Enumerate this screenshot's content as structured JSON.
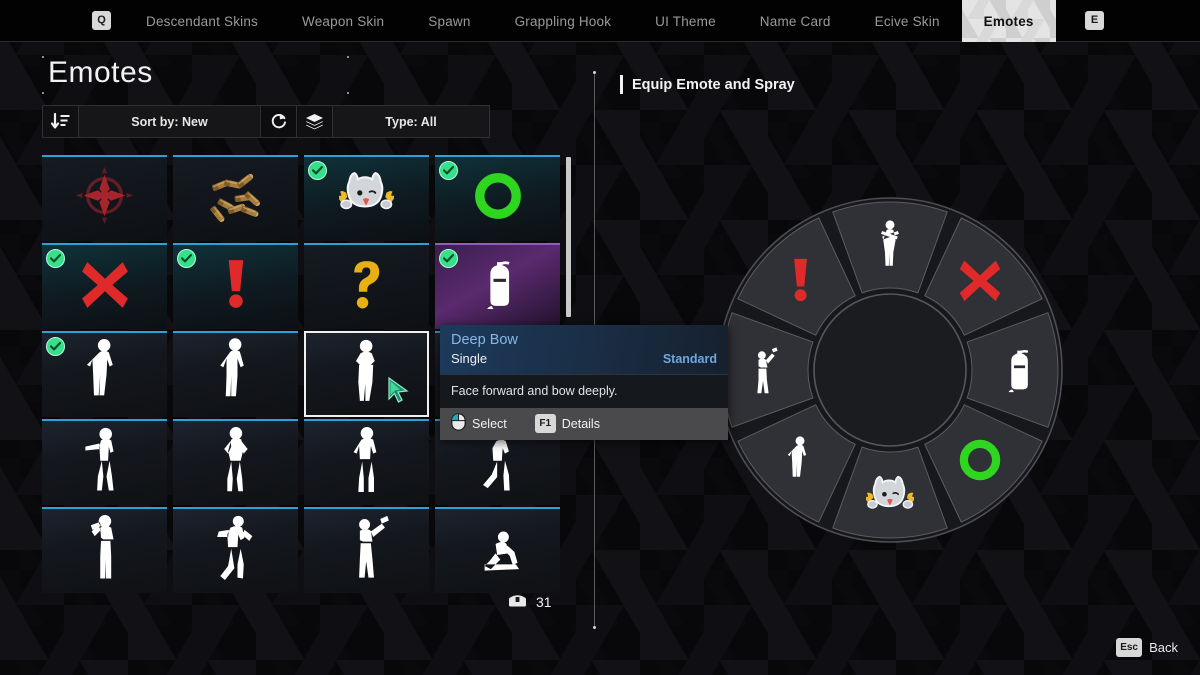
{
  "topnav": {
    "left_key": "Q",
    "right_key": "E",
    "tabs": [
      {
        "label": "Descendant Skins",
        "active": false
      },
      {
        "label": "Weapon Skin",
        "active": false
      },
      {
        "label": "Spawn",
        "active": false
      },
      {
        "label": "Grappling Hook",
        "active": false
      },
      {
        "label": "UI Theme",
        "active": false
      },
      {
        "label": "Name Card",
        "active": false
      },
      {
        "label": "Ecive Skin",
        "active": false
      },
      {
        "label": "Emotes",
        "active": true
      }
    ]
  },
  "left_panel": {
    "title": "Emotes",
    "filter": {
      "sort_icon": "sort-descending-icon",
      "sort_label": "Sort by: New",
      "reset_icon": "reset-icon",
      "layers_icon": "layers-icon",
      "type_label": "Type: All"
    },
    "grid": [
      {
        "name": "crosshair-target-spray",
        "kind": "spray",
        "glyph": "crosshair",
        "color": "#c0282f",
        "style": "dark",
        "owned": false,
        "selected": false
      },
      {
        "name": "ammo-bullets-spray",
        "kind": "spray",
        "glyph": "bullets",
        "color": "#c89a52",
        "style": "dark",
        "owned": false,
        "selected": false
      },
      {
        "name": "mascot-chicken-sticker",
        "kind": "spray",
        "glyph": "mascot",
        "color": "#d6d8dc",
        "style": "teal",
        "owned": true,
        "selected": false
      },
      {
        "name": "green-ring-o-spray",
        "kind": "spray",
        "glyph": "O",
        "color": "#2fd61f",
        "style": "teal",
        "owned": true,
        "selected": false
      },
      {
        "name": "red-x-spray",
        "kind": "spray",
        "glyph": "X",
        "color": "#e02a2a",
        "style": "teal",
        "owned": true,
        "selected": false
      },
      {
        "name": "red-exclamation-spray",
        "kind": "spray",
        "glyph": "!",
        "color": "#e02a2a",
        "style": "teal",
        "owned": true,
        "selected": false
      },
      {
        "name": "yellow-question-spray",
        "kind": "spray",
        "glyph": "?",
        "color": "#e8b014",
        "style": "dark",
        "owned": false,
        "selected": false
      },
      {
        "name": "spray-can-spray",
        "kind": "spray",
        "glyph": "spraycan",
        "color": "#ffffff",
        "style": "purple",
        "owned": true,
        "selected": false
      },
      {
        "name": "emote-mic-pose",
        "kind": "emote",
        "glyph": "pose-mic",
        "color": "#ffffff",
        "style": "",
        "owned": true,
        "selected": false
      },
      {
        "name": "emote-salute-pose",
        "kind": "emote",
        "glyph": "pose-salute",
        "color": "#ffffff",
        "style": "",
        "owned": false,
        "selected": false
      },
      {
        "name": "emote-deep-bow",
        "kind": "emote",
        "glyph": "pose-bow",
        "color": "#ffffff",
        "style": "",
        "owned": false,
        "selected": true
      },
      {
        "name": "emote-kick-pose",
        "kind": "emote",
        "glyph": "pose-kick",
        "color": "#ffffff",
        "style": "",
        "owned": false,
        "selected": false
      },
      {
        "name": "emote-point-pose",
        "kind": "emote",
        "glyph": "pose-point",
        "color": "#ffffff",
        "style": "",
        "owned": false,
        "selected": false
      },
      {
        "name": "emote-flex-pose",
        "kind": "emote",
        "glyph": "pose-flex",
        "color": "#ffffff",
        "style": "",
        "owned": false,
        "selected": false
      },
      {
        "name": "emote-stand-pose",
        "kind": "emote",
        "glyph": "pose-stand",
        "color": "#ffffff",
        "style": "",
        "owned": false,
        "selected": false
      },
      {
        "name": "emote-legup-pose",
        "kind": "emote",
        "glyph": "pose-legup",
        "color": "#ffffff",
        "style": "",
        "owned": false,
        "selected": false
      },
      {
        "name": "emote-clap-pose",
        "kind": "emote",
        "glyph": "pose-clap",
        "color": "#ffffff",
        "style": "",
        "owned": false,
        "selected": false
      },
      {
        "name": "emote-dance-pose",
        "kind": "emote",
        "glyph": "pose-dance",
        "color": "#ffffff",
        "style": "",
        "owned": false,
        "selected": false
      },
      {
        "name": "emote-wave-pose",
        "kind": "emote",
        "glyph": "pose-wave",
        "color": "#ffffff",
        "style": "",
        "owned": false,
        "selected": false
      },
      {
        "name": "emote-sit-pose",
        "kind": "emote",
        "glyph": "pose-sit",
        "color": "#ffffff",
        "style": "",
        "owned": false,
        "selected": false
      }
    ],
    "currency": {
      "icon": "chest-icon",
      "count": "31"
    }
  },
  "tooltip": {
    "name": "Deep Bow",
    "type": "Single",
    "rarity": "Standard",
    "description": "Face forward and bow deeply.",
    "select_icon": "mouse-left-click-icon",
    "select_label": "Select",
    "details_key": "F1",
    "details_label": "Details"
  },
  "right_panel": {
    "header": "Equip Emote and Spray",
    "wheel": {
      "slots": [
        {
          "name": "wheel-slot-top",
          "glyph": "pose-arms-crossed",
          "color": "#ffffff"
        },
        {
          "name": "wheel-slot-top-right",
          "glyph": "X",
          "color": "#e02a2a"
        },
        {
          "name": "wheel-slot-right",
          "glyph": "spraycan",
          "color": "#ffffff"
        },
        {
          "name": "wheel-slot-bottom-right",
          "glyph": "O",
          "color": "#2fd61f"
        },
        {
          "name": "wheel-slot-bottom",
          "glyph": "mascot",
          "color": "#d6d8dc"
        },
        {
          "name": "wheel-slot-bottom-left",
          "glyph": "pose-mic",
          "color": "#ffffff"
        },
        {
          "name": "wheel-slot-left",
          "glyph": "pose-raise",
          "color": "#ffffff"
        },
        {
          "name": "wheel-slot-top-left",
          "glyph": "!",
          "color": "#e02a2a"
        }
      ]
    }
  },
  "footer": {
    "back_key": "Esc",
    "back_label": "Back"
  }
}
